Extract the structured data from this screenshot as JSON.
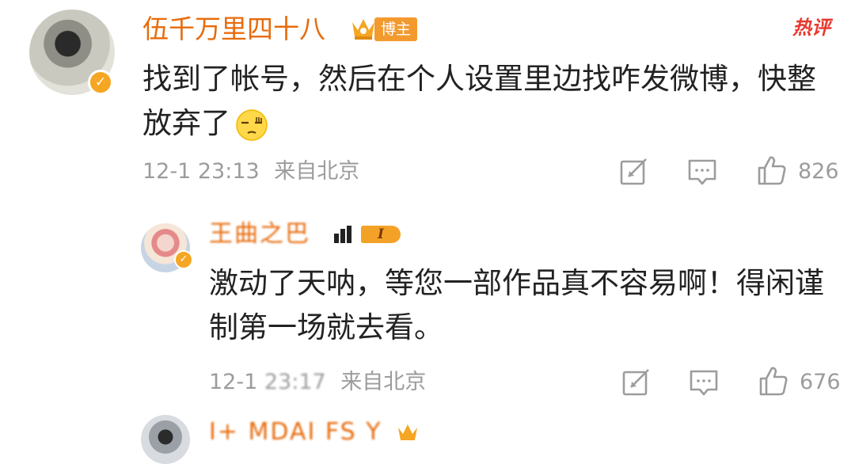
{
  "comments": [
    {
      "name": "伍千万里四十八",
      "badge": "博主",
      "hot_label": "热评",
      "text": "找到了帐号，然后在个人设置里边找咋发微博，快整放弃了",
      "time": "12-1 23:13",
      "location": "来自北京",
      "likes": "826"
    },
    {
      "name": "王曲之巴",
      "rank": "I",
      "text": "激动了天呐，等您一部作品真不容易啊！得闲谨制第一场就去看。",
      "time_prefix": "12-1",
      "time_obscured": "23:17",
      "location": "来自北京",
      "likes": "676"
    },
    {
      "name": "I+ MDAI FS Y"
    }
  ],
  "colors": {
    "name": "#e86b0c",
    "meta": "#9c9c9c",
    "verified_badge": "#f5a623",
    "hot": "#e8392f"
  },
  "icons": [
    "crown-icon",
    "verified-icon",
    "squint-emoji-icon",
    "repost-icon",
    "comment-icon",
    "like-icon"
  ]
}
